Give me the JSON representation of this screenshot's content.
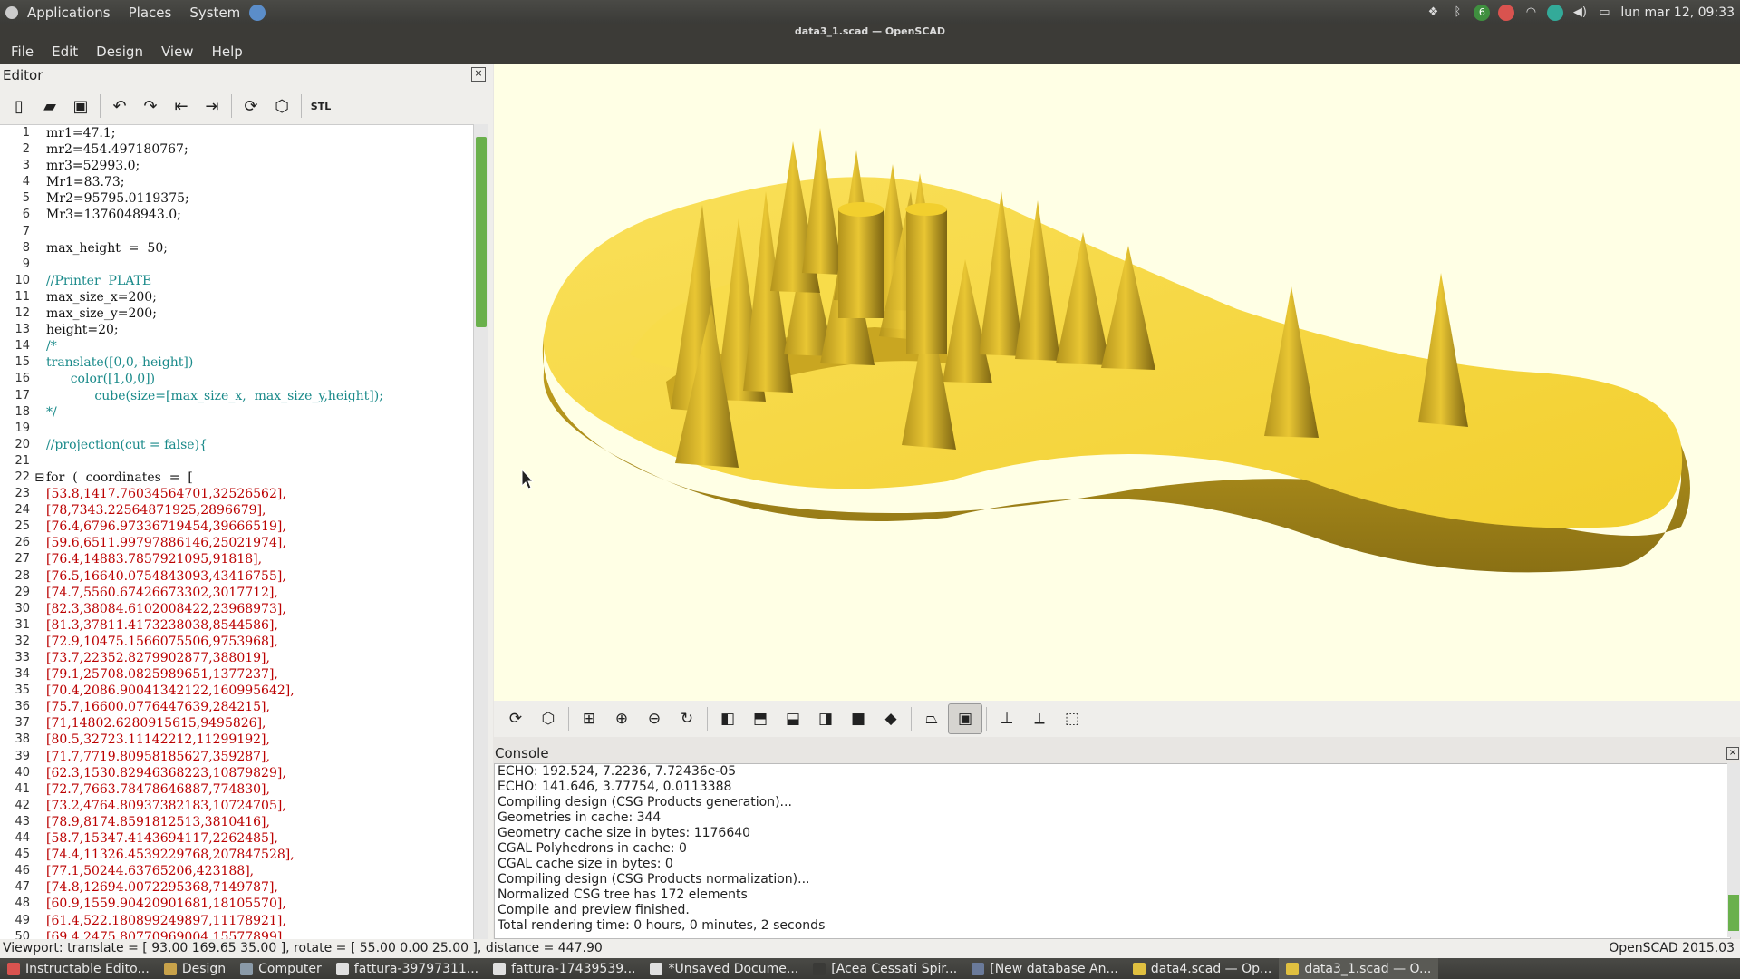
{
  "top_panel": {
    "menus": [
      "Applications",
      "Places",
      "System"
    ],
    "badge": "6",
    "datetime": "lun mar 12, 09:33"
  },
  "window_title": "data3_1.scad — OpenSCAD",
  "menubar": [
    "File",
    "Edit",
    "Design",
    "View",
    "Help"
  ],
  "editor": {
    "label": "Editor",
    "toolbar": [
      "new-file-icon",
      "open-file-icon",
      "save-file-icon",
      "undo-icon",
      "redo-icon",
      "unindent-icon",
      "indent-icon",
      "preview-icon",
      "render-icon",
      "export-stl-icon"
    ],
    "stl_label": "STL",
    "lines": [
      "mr1=47.1;",
      "mr2=454.497180767;",
      "mr3=52993.0;",
      "Mr1=83.73;",
      "Mr2=95795.0119375;",
      "Mr3=1376048943.0;",
      "",
      "max_height  =  50;",
      "",
      "//Printer  PLATE",
      "max_size_x=200;",
      "max_size_y=200;",
      "height=20;",
      "/*",
      "translate([0,0,-height])",
      "      color([1,0,0])",
      "            cube(size=[max_size_x,  max_size_y,height]);",
      "*/",
      "",
      "//projection(cut = false){",
      "",
      "for  (  coordinates  =  [",
      "[53.8,1417.76034564701,32526562],",
      "[78,7343.22564871925,2896679],",
      "[76.4,6796.97336719454,39666519],",
      "[59.6,6511.99797886146,25021974],",
      "[76.4,14883.7857921095,91818],",
      "[76.5,16640.0754843093,43416755],",
      "[74.7,5560.67426673302,3017712],",
      "[82.3,38084.6102008422,23968973],",
      "[81.3,37811.4173238038,8544586],",
      "[72.9,10475.1566075506,9753968],",
      "[73.7,22352.8279902877,388019],",
      "[79.1,25708.0825989651,1377237],",
      "[70.4,2086.90041342122,160995642],",
      "[75.7,16600.0776447639,284215],",
      "[71,14802.6280915615,9495826],",
      "[80.5,32723.11142212,11299192],",
      "[71.7,7719.80958185627,359287],",
      "[62.3,1530.82946368223,10879829],",
      "[72.7,7663.78478646887,774830],",
      "[73.2,4764.80937382183,10724705],",
      "[78.9,8174.8591812513,3810416],",
      "[58.7,15347.4143694117,2262485],",
      "[74.4,11326.4539229768,207847528],",
      "[77.1,50244.63765206,423188],",
      "[74.8,12694.0072295368,7149787],",
      "[60.9,1559.90420901681,18105570],",
      "[61.4,522.180899249897,11178921],",
      "[69.4,2475.80770969004,15577899],"
    ],
    "line_styles": [
      "n",
      "n",
      "n",
      "n",
      "n",
      "n",
      "e",
      "n",
      "e",
      "c",
      "n",
      "n",
      "n",
      "c",
      "c",
      "c",
      "c",
      "c",
      "e",
      "c",
      "e",
      "k",
      "d",
      "d",
      "d",
      "d",
      "d",
      "d",
      "d",
      "d",
      "d",
      "d",
      "d",
      "d",
      "d",
      "d",
      "d",
      "d",
      "d",
      "d",
      "d",
      "d",
      "d",
      "d",
      "d",
      "d",
      "d",
      "d",
      "d",
      "d"
    ]
  },
  "view_toolbar": [
    "preview-icon",
    "render-icon",
    "zoom-all-icon",
    "zoom-in-icon",
    "zoom-out-icon",
    "reset-view-icon",
    "view-right-icon",
    "view-top-icon",
    "view-bottom-icon",
    "view-left-icon",
    "view-front-icon",
    "view-back-icon",
    "perspective-icon",
    "orthogonal-icon",
    "show-axes-icon",
    "show-scale-icon",
    "show-edges-icon"
  ],
  "console": {
    "label": "Console",
    "lines": [
      "ECHO: 192.524, 7.2236, 7.72436e-05",
      "ECHO: 141.646, 3.77754, 0.0113388",
      "Compiling design (CSG Products generation)...",
      "Geometries in cache: 344",
      "Geometry cache size in bytes: 1176640",
      "CGAL Polyhedrons in cache: 0",
      "CGAL cache size in bytes: 0",
      "Compiling design (CSG Products normalization)...",
      "Normalized CSG tree has 172 elements",
      "Compile and preview finished.",
      "Total rendering time: 0 hours, 0 minutes, 2 seconds"
    ]
  },
  "status": {
    "viewport": "Viewport: translate = [ 93.00 169.65 35.00 ], rotate = [ 55.00 0.00 25.00 ], distance = 447.90",
    "version": "OpenSCAD 2015.03"
  },
  "taskbar": [
    {
      "label": "Instructable Edito...",
      "color": "#d9534f"
    },
    {
      "label": "Design",
      "color": "#c8a24a"
    },
    {
      "label": "Computer",
      "color": "#8a9aa8"
    },
    {
      "label": "fattura-39797311...",
      "color": "#e0e0e0"
    },
    {
      "label": "fattura-17439539...",
      "color": "#e0e0e0"
    },
    {
      "label": "*Unsaved Docume...",
      "color": "#e0e0e0"
    },
    {
      "label": "[Acea Cessati Spir...",
      "color": "#3a3a37"
    },
    {
      "label": "[New database An...",
      "color": "#6a7a9a"
    },
    {
      "label": "data4.scad — Op...",
      "color": "#e0c040"
    },
    {
      "label": "data3_1.scad — O...",
      "color": "#e0c040"
    }
  ],
  "colors": {
    "viewport_bg": "#ffffe5",
    "model_yellow": "#f5d53a",
    "accent_green": "#6ab04c"
  }
}
